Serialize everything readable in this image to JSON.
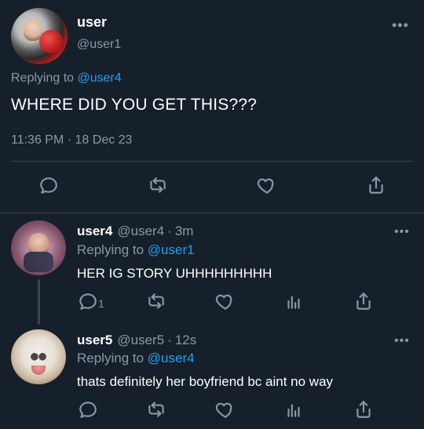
{
  "main_tweet": {
    "name": "user",
    "handle": "@user1",
    "replying_prefix": "Replying to",
    "replying_to": "@user4",
    "text": "WHERE DID YOU GET THIS???",
    "timestamp": "11:36 PM · 18 Dec 23",
    "more": "•••"
  },
  "replies": [
    {
      "name": "user4",
      "handle": "@user4",
      "time": "3m",
      "replying_prefix": "Replying to",
      "replying_to": "@user1",
      "text": "HER IG STORY UHHHHHHHHH",
      "reply_count": "1",
      "more": "•••"
    },
    {
      "name": "user5",
      "handle": "@user5",
      "time": "12s",
      "replying_prefix": "Replying to",
      "replying_to": "@user4",
      "text": "thats definitely her boyfriend bc aint no way",
      "more": "•••"
    }
  ],
  "ui": {
    "icons": {
      "reply": "reply-icon",
      "retweet": "retweet-icon",
      "like": "heart-icon",
      "share": "share-icon",
      "stats": "stats-icon"
    },
    "colors": {
      "background": "#15202b",
      "text": "#ffffff",
      "muted": "#8899a6",
      "accent": "#1da1f2",
      "divider": "#38444d"
    }
  }
}
